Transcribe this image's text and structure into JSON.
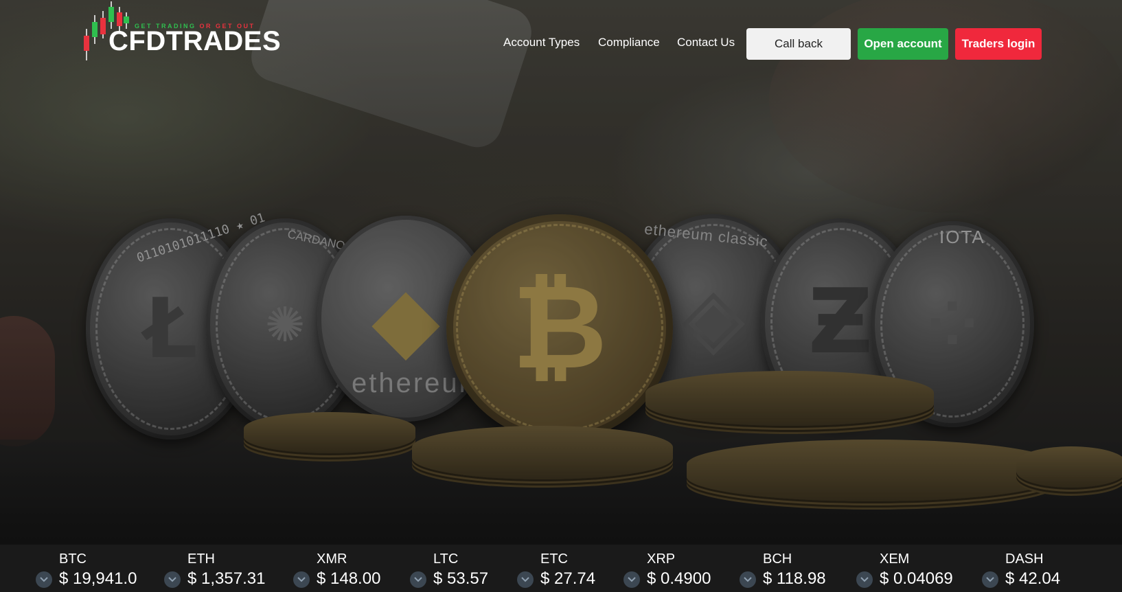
{
  "brand": {
    "name": "CFDTRADES",
    "tagline_green": "GET TRADING",
    "tagline_red": "OR GET OUT",
    "colors": {
      "green": "#2fbf4f",
      "red": "#e8323e"
    }
  },
  "nav": {
    "links": [
      "Account Types",
      "Compliance",
      "Contact Us"
    ]
  },
  "buttons": {
    "call_back": "Call back",
    "open_account": "Open account",
    "traders_login": "Traders login",
    "colors": {
      "open_account": "#28a745",
      "traders_login": "#f0283c",
      "call_back": "#f1f1f1"
    }
  },
  "hero": {
    "coin_texts": {
      "ltc": "0110101011110 ★ 01",
      "cardano": "CARDANO",
      "eth": "ethereum",
      "etc": "ethereum classic",
      "iota": "IOTA"
    }
  },
  "ticker": [
    {
      "symbol": "BTC",
      "price": "$ 19,941.0",
      "direction": "down"
    },
    {
      "symbol": "ETH",
      "price": "$ 1,357.31",
      "direction": "down"
    },
    {
      "symbol": "XMR",
      "price": "$ 148.00",
      "direction": "down"
    },
    {
      "symbol": "LTC",
      "price": "$ 53.57",
      "direction": "down"
    },
    {
      "symbol": "ETC",
      "price": "$ 27.74",
      "direction": "down"
    },
    {
      "symbol": "XRP",
      "price": "$ 0.4900",
      "direction": "down"
    },
    {
      "symbol": "BCH",
      "price": "$ 118.98",
      "direction": "down"
    },
    {
      "symbol": "XEM",
      "price": "$ 0.04069",
      "direction": "down"
    },
    {
      "symbol": "DASH",
      "price": "$ 42.04",
      "direction": "down"
    }
  ]
}
